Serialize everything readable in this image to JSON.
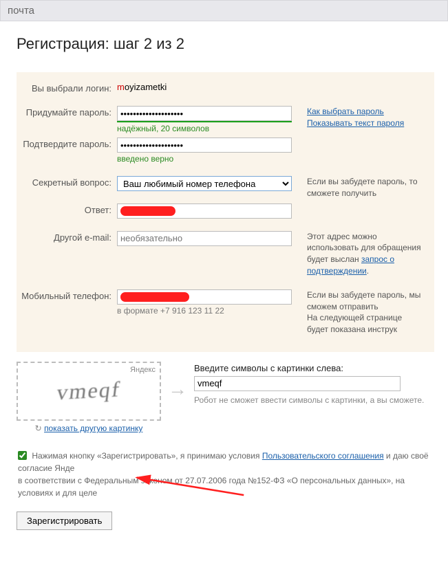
{
  "header": {
    "title": "почта"
  },
  "page": {
    "title": "Регистрация: шаг 2 из 2"
  },
  "fields": {
    "login_label": "Вы выбрали логин:",
    "login_m": "m",
    "login_rest": "oyizametki",
    "password_label": "Придумайте пароль:",
    "password_value": "••••••••••••••••••••",
    "password_links": {
      "how": "Как выбрать пароль",
      "show": "Показывать текст пароля"
    },
    "password_strength": "надёжный, 20 символов",
    "password2_label": "Подтвердите пароль:",
    "password2_value": "••••••••••••••••••••",
    "password2_sub": "введено верно",
    "secret_label": "Секретный вопрос:",
    "secret_selected": "Ваш любимый номер телефона",
    "secret_hint": "Если вы забудете пароль, то сможете получить",
    "answer_label": "Ответ:",
    "other_email_label": "Другой e-mail:",
    "other_email_placeholder": "необязательно",
    "other_email_hint": "Этот адрес можно использовать для обращения ",
    "other_email_hint2_pre": "будет выслан ",
    "other_email_hint2_link": "запрос о подтверждении",
    "phone_label": "Мобильный телефон:",
    "phone_hint1": "Если вы забудете пароль, мы сможем отправить",
    "phone_hint2": "На следующей странице будет показана инструк",
    "phone_sub": "в формате +7 916 123 11 22"
  },
  "captcha": {
    "brand": "Яндекс",
    "text": "vmeqf",
    "show_other": "показать другую картинку",
    "label": "Введите символы с картинки слева:",
    "value": "vmeqf",
    "sub": "Робот не сможет ввести символы с картинки, а вы сможете."
  },
  "agree": {
    "text_pre": "Нажимая кнопку «Зарегистрировать», я принимаю условия ",
    "link": "Пользовательского соглашения",
    "text_post": " и даю своё согласие Янде",
    "text_line2": "в соответствии с Федеральным законом от 27.07.2006 года №152-ФЗ «О персональных данных», на условиях и для целе"
  },
  "button": {
    "submit": "Зарегистрировать"
  }
}
